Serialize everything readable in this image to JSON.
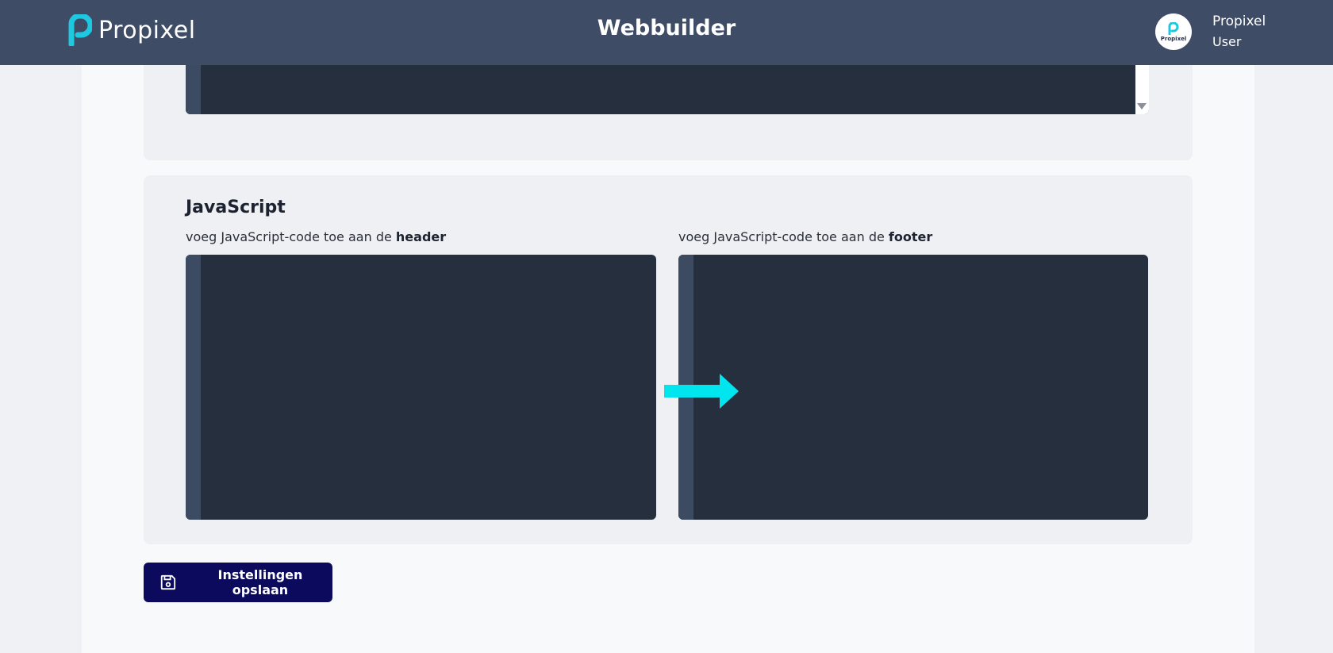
{
  "header": {
    "logo_text": "Propixel",
    "title": "Webbuilder",
    "avatar_text": "Propixel",
    "user_name": "Propixel",
    "user_role": "User"
  },
  "javascript_section": {
    "title": "JavaScript",
    "header_label_prefix": "voeg JavaScript-code toe aan de ",
    "header_label_bold": "header",
    "footer_label_prefix": "voeg JavaScript-code toe aan de ",
    "footer_label_bold": "footer"
  },
  "actions": {
    "save_label": "Instellingen opslaan"
  },
  "colors": {
    "topbar": "#3f4c66",
    "accent": "#1ec8e0",
    "editor_bg": "#262f3e",
    "editor_gutter": "#3c4a62",
    "save_button": "#0b0a5c",
    "annotation_arrow": "#00e5ee"
  },
  "icons": {
    "logo": "propixel-logo-icon",
    "save": "floppy-disk-icon",
    "arrow": "arrow-right-icon",
    "scroll": "scroll-down-icon"
  }
}
